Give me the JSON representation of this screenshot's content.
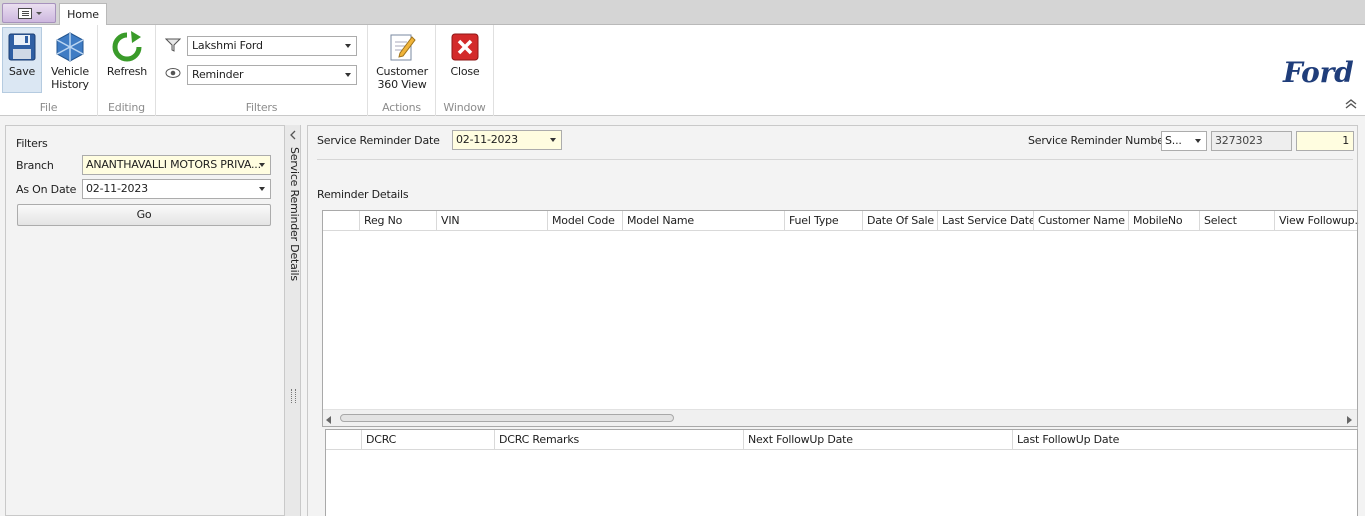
{
  "tabs": {
    "home": "Home"
  },
  "ribbon": {
    "file": {
      "label": "File",
      "save": "Save",
      "vehicle_history_1": "Vehicle",
      "vehicle_history_2": "History"
    },
    "editing": {
      "label": "Editing",
      "refresh": "Refresh"
    },
    "filters": {
      "label": "Filters",
      "dealer": "Lakshmi Ford",
      "view": "Reminder"
    },
    "actions": {
      "label": "Actions",
      "customer_360_1": "Customer",
      "customer_360_2": "360 View"
    },
    "window": {
      "label": "Window",
      "close": "Close"
    },
    "logo": "Ford"
  },
  "left_panel": {
    "title": "Filters",
    "branch_label": "Branch",
    "branch_value": "ANANTHAVALLI MOTORS PRIVA...",
    "as_on_date_label": "As On Date",
    "as_on_date_value": "02-11-2023",
    "go": "Go",
    "side_tab": "Service Reminder Details"
  },
  "main": {
    "reminder_date_label": "Service Reminder Date",
    "reminder_date_value": "02-11-2023",
    "reminder_number_label": "Service Reminder Number",
    "reminder_series": "S...",
    "reminder_number": "3273023",
    "reminder_count": "1",
    "details_label": "Reminder Details",
    "grid1_columns": [
      "",
      "Reg No",
      "VIN",
      "Model Code",
      "Model Name",
      "Fuel Type",
      "Date Of Sale",
      "Last Service Date",
      "Customer Name",
      "MobileNo",
      "Select",
      "View Followup..."
    ],
    "grid2_columns": [
      "",
      "DCRC",
      "DCRC Remarks",
      "Next FollowUp Date",
      "Last FollowUp Date"
    ]
  },
  "colors": {
    "accent": "#dbe7f3",
    "yellow_field": "#fffde0",
    "ford_blue": "#1f3d7a",
    "close_red": "#d32a2a",
    "refresh_green": "#3a9b2a"
  }
}
